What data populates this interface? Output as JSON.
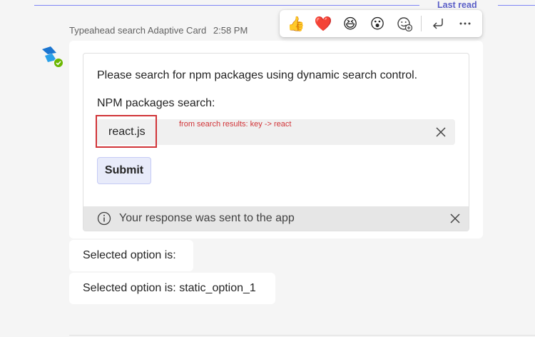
{
  "last_read": {
    "label": "Last read"
  },
  "message": {
    "sender": "Typeahead search Adaptive Card",
    "time": "2:58 PM"
  },
  "reactions": [
    {
      "name": "like",
      "glyph": "👍"
    },
    {
      "name": "heart",
      "glyph": "❤️"
    },
    {
      "name": "laugh",
      "glyph": "😆"
    },
    {
      "name": "surprised",
      "glyph": "😮"
    }
  ],
  "card": {
    "instructions": "Please search for npm packages using dynamic search control.",
    "search_label": "NPM packages search:",
    "search_value": "react.js",
    "annotation": "from search results: key -> react",
    "submit_label": "Submit",
    "status_text": "Your response was sent to the app"
  },
  "replies": [
    {
      "text": "Selected option is:"
    },
    {
      "text": "Selected option is: static_option_1"
    }
  ],
  "colors": {
    "accent": "#5b5fc7",
    "annotation": "#d13438",
    "presence": "#6bb700",
    "submit_bg": "#e8ebfa"
  }
}
